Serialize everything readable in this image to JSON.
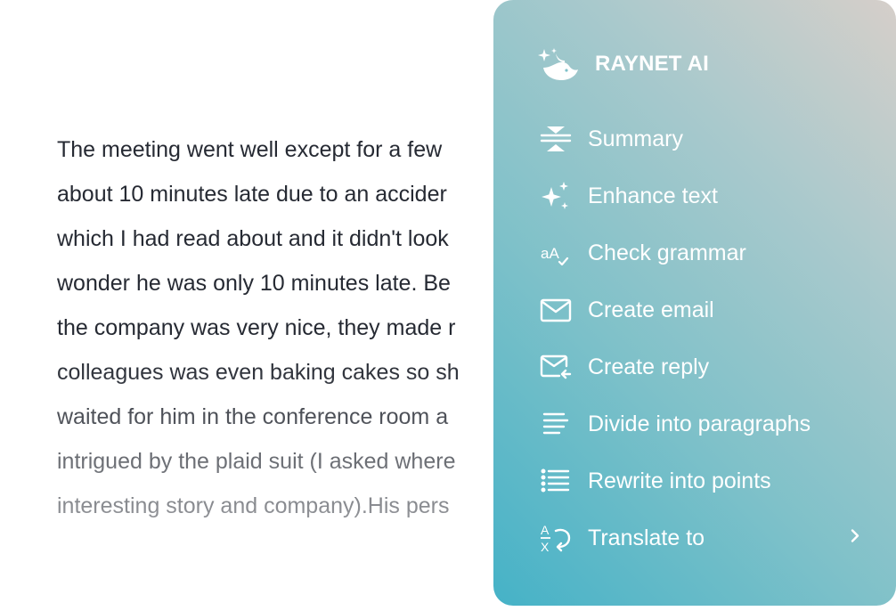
{
  "document": {
    "lines": [
      "The meeting went well except for a few",
      "about 10 minutes late due to an accider",
      "which I had read about and it didn't look",
      "wonder he was only 10 minutes late. Be",
      "the company was very nice, they made r",
      "colleagues was even baking cakes so sh",
      "waited for him in the conference room a",
      "intrigued by the plaid suit (I asked where",
      "interesting story and company).His pers"
    ]
  },
  "panel": {
    "title": "RAYNET AI",
    "logo_icon": "sparkle-whale-icon",
    "menu": [
      {
        "label": "Summary",
        "icon": "summary-icon"
      },
      {
        "label": "Enhance text",
        "icon": "sparkles-icon"
      },
      {
        "label": "Check grammar",
        "icon": "grammar-check-icon"
      },
      {
        "label": "Create email",
        "icon": "envelope-icon"
      },
      {
        "label": "Create reply",
        "icon": "envelope-reply-icon"
      },
      {
        "label": "Divide into paragraphs",
        "icon": "paragraphs-icon"
      },
      {
        "label": "Rewrite into points",
        "icon": "bullet-list-icon"
      },
      {
        "label": "Translate to",
        "icon": "translate-icon",
        "submenu_icon": "chevron-right-icon"
      }
    ]
  },
  "colors": {
    "text": "#262a33",
    "panel_gradient_start": "#d6cfca",
    "panel_gradient_end": "#45b2c7",
    "panel_text": "#ffffff"
  }
}
